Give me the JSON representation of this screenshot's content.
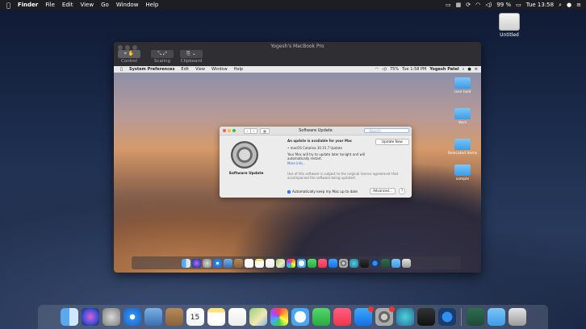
{
  "menubar": {
    "apple": "",
    "app": "Finder",
    "items": [
      "File",
      "Edit",
      "View",
      "Go",
      "Window",
      "Help"
    ],
    "battery": "99 %",
    "clock": "Tue 13:58"
  },
  "desktop": {
    "drive_label": "Untitled"
  },
  "remote_window": {
    "title": "Yogesh's MacBook Pro",
    "tools": [
      "Control",
      "Scaling",
      "Clipboard"
    ],
    "menubar": {
      "app": "System Preferences",
      "items": [
        "Edit",
        "View",
        "Window",
        "Help"
      ],
      "battery": "75%",
      "clock": "Tue 1:58 PM",
      "user": "Yogesh Patel"
    },
    "folders": [
      "core hold",
      "docs",
      "Relocated Items",
      "sample"
    ]
  },
  "software_update": {
    "title": "Software Update",
    "search_placeholder": "Search",
    "pane_label": "Software Update",
    "heading": "An update is available for your Mac",
    "update_button": "Update Now",
    "item": "• macOS Catalina 10.15.7 Update",
    "note_line1": "Your Mac will try to update later tonight and will",
    "note_line2": "automatically restart.",
    "more_info": "More info...",
    "license_line1": "Use of this software is subject to the original licence agreement that",
    "license_line2": "accompanied the software being updated.",
    "auto_update_label": "Automatically keep my Mac up to date",
    "advanced_button": "Advanced...",
    "help_button": "?"
  },
  "dock_icons": [
    "finder",
    "siri",
    "launchpad",
    "safari",
    "photo-viewer",
    "contacts",
    "calendar",
    "notes",
    "reminders",
    "maps",
    "photos",
    "messages",
    "facetime",
    "music",
    "app-store",
    "system-preferences",
    "screen-sharing",
    "terminal",
    "browser",
    "preview",
    "downloads-folder",
    "trash"
  ],
  "calendar_day": "15"
}
